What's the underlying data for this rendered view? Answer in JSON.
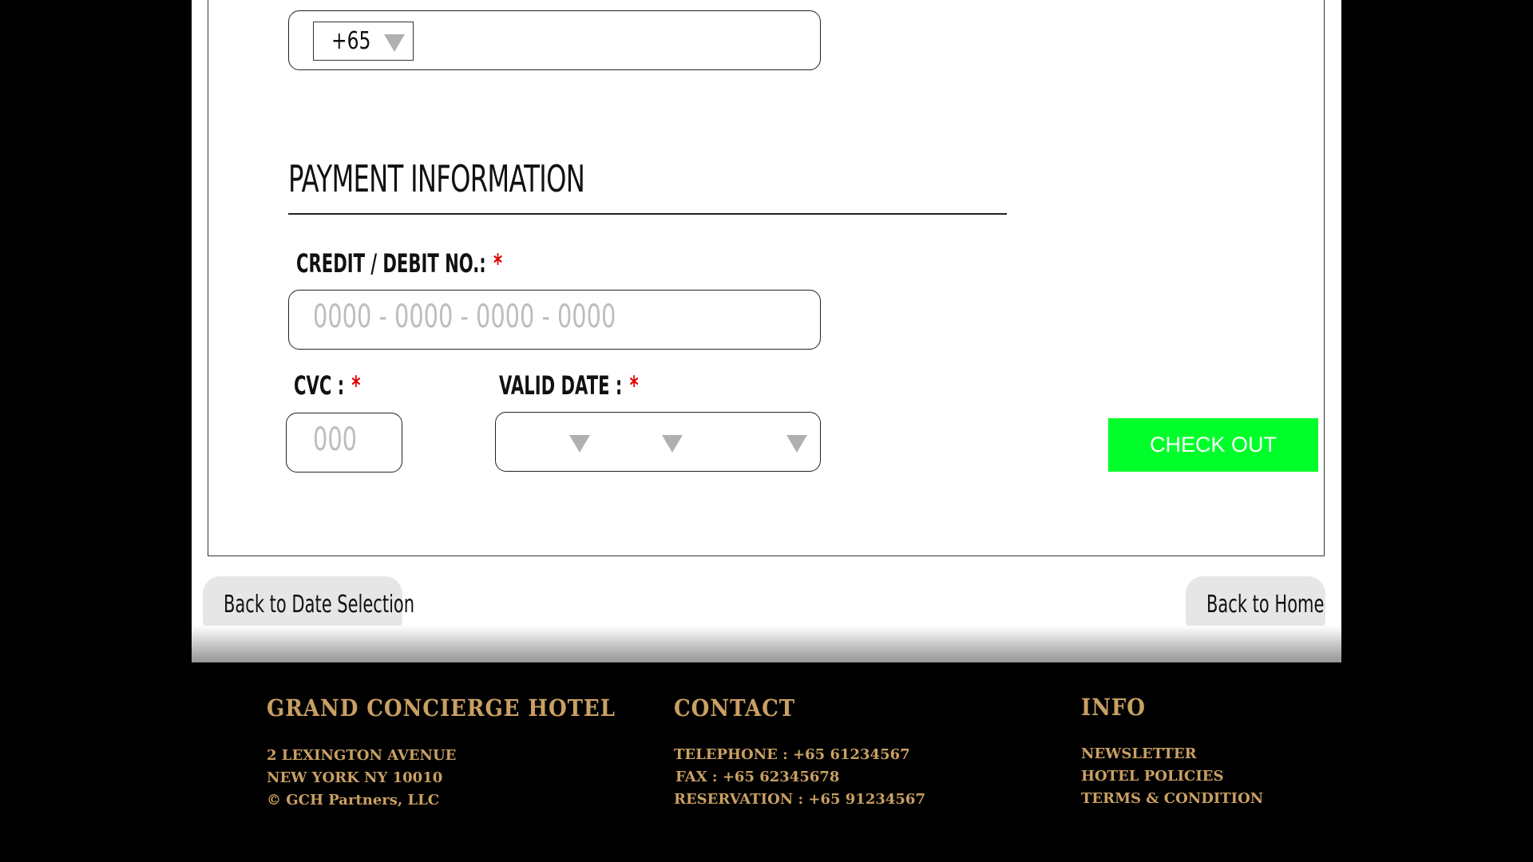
{
  "phone": {
    "country_code": "+65"
  },
  "payment": {
    "section_title": "PAYMENT INFORMATION",
    "card_label": "CREDIT / DEBIT NO.:",
    "card_placeholder": "0000 - 0000 - 0000 - 0000",
    "cvc_label": "CVC :",
    "cvc_placeholder": "000",
    "valid_date_label": "VALID DATE :",
    "required_mark": "*",
    "checkout_label": "CHECK OUT"
  },
  "nav": {
    "back_date_label": "Back to Date Selection",
    "back_home_label": "Back to Home"
  },
  "footer": {
    "hotel": {
      "title": "GRAND CONCIERGE HOTEL",
      "address_line1": "2 LEXINGTON AVENUE",
      "address_line2": "NEW YORK NY 10010",
      "copyright": "© GCH Partners, LLC"
    },
    "contact": {
      "title": "CONTACT",
      "telephone": "TELEPHONE : +65 61234567",
      "fax": "FAX : +65 62345678",
      "reservation": "RESERVATION : +65 91234567"
    },
    "info": {
      "title": "INFO",
      "links": [
        "NEWSLETTER",
        "HOTEL POLICIES",
        "TERMS & CONDITION"
      ]
    }
  },
  "colors": {
    "accent_gold": "#c9a063",
    "checkout_green": "#00ff2a",
    "required_red": "#e00000"
  }
}
